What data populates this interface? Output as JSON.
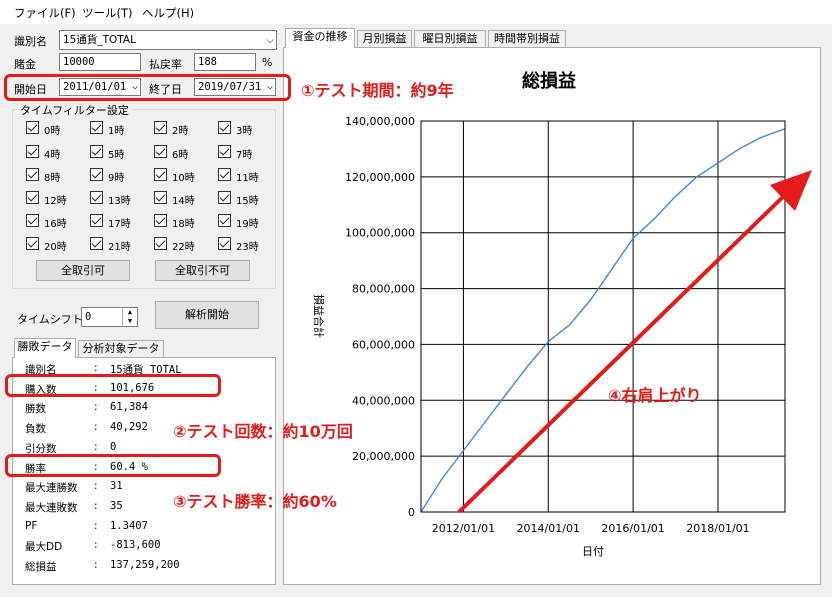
{
  "menu": {
    "file": "ファイル(F)",
    "tools": "ツール(T)",
    "help": "ヘルプ(H)"
  },
  "settings": {
    "id_label": "識別名",
    "id_value": "15通貨_TOTAL",
    "bet_label": "賭金",
    "bet_value": "10000",
    "payout_label": "払戻率",
    "payout_value": "188",
    "payout_unit": "%",
    "start_label": "開始日",
    "start_value": "2011/01/01",
    "end_label": "終了日",
    "end_value": "2019/07/31"
  },
  "time_filter": {
    "title": "タイムフィルター設定",
    "hours": [
      "0時",
      "1時",
      "2時",
      "3時",
      "4時",
      "5時",
      "6時",
      "7時",
      "8時",
      "9時",
      "10時",
      "11時",
      "12時",
      "13時",
      "14時",
      "15時",
      "16時",
      "17時",
      "18時",
      "19時",
      "20時",
      "21時",
      "22時",
      "23時"
    ],
    "check_all": "全取引可",
    "uncheck_all": "全取引不可"
  },
  "timeshift": {
    "label": "タイムシフト",
    "value": "0"
  },
  "analyze_button": "解析開始",
  "result_tabs": {
    "tab1": "勝敗データ",
    "tab2": "分析対象データ"
  },
  "stats": [
    {
      "label": "識別名",
      "value": "15通貨_TOTAL"
    },
    {
      "label": "購入数",
      "value": "101,676"
    },
    {
      "label": "勝数",
      "value": "61,384"
    },
    {
      "label": "負数",
      "value": "40,292"
    },
    {
      "label": "引分数",
      "value": "0"
    },
    {
      "label": "勝率",
      "value": "60.4 %"
    },
    {
      "label": "最大連勝数",
      "value": "31"
    },
    {
      "label": "最大連敗数",
      "value": "35"
    },
    {
      "label": "PF",
      "value": "1.3407"
    },
    {
      "label": "最大DD",
      "value": "-813,600"
    },
    {
      "label": "総損益",
      "value": "137,259,200"
    }
  ],
  "stat_sep": ":",
  "chart_tabs": {
    "tab1": "資金の推移",
    "tab2": "月別損益",
    "tab3": "曜日別損益",
    "tab4": "時間帯別損益"
  },
  "chart_data": {
    "type": "line",
    "title": "総損益",
    "xlabel": "日付",
    "ylabel": "損益合計",
    "x_ticks": [
      "2012/01/01",
      "2014/01/01",
      "2016/01/01",
      "2018/01/01"
    ],
    "y_ticks": [
      "0",
      "20,000,000",
      "40,000,000",
      "60,000,000",
      "80,000,000",
      "100,000,000",
      "120,000,000",
      "140,000,000"
    ],
    "ylim": [
      0,
      140000000
    ],
    "xlim": [
      2011.0,
      2019.58
    ],
    "series": [
      {
        "color": "#3a7fd5",
        "x": [
          2011.0,
          2011.5,
          2012.0,
          2012.5,
          2013.0,
          2013.5,
          2014.0,
          2014.5,
          2015.0,
          2015.5,
          2016.0,
          2016.5,
          2017.0,
          2017.5,
          2018.0,
          2018.5,
          2019.0,
          2019.58
        ],
        "y": [
          0,
          12000000,
          22000000,
          32000000,
          42000000,
          52000000,
          61000000,
          67000000,
          76000000,
          87000000,
          98000000,
          105000000,
          113000000,
          120000000,
          125000000,
          130000000,
          134000000,
          137259200
        ]
      }
    ],
    "grid": true
  },
  "annotations": {
    "a1": "①テスト期間：約9年",
    "a2": "②テスト回数：約10万回",
    "a3": "③テスト勝率：約60%",
    "a4": "④右肩上がり"
  },
  "colors": {
    "highlight": "#e31b1b",
    "series": "#3a7fd5"
  }
}
